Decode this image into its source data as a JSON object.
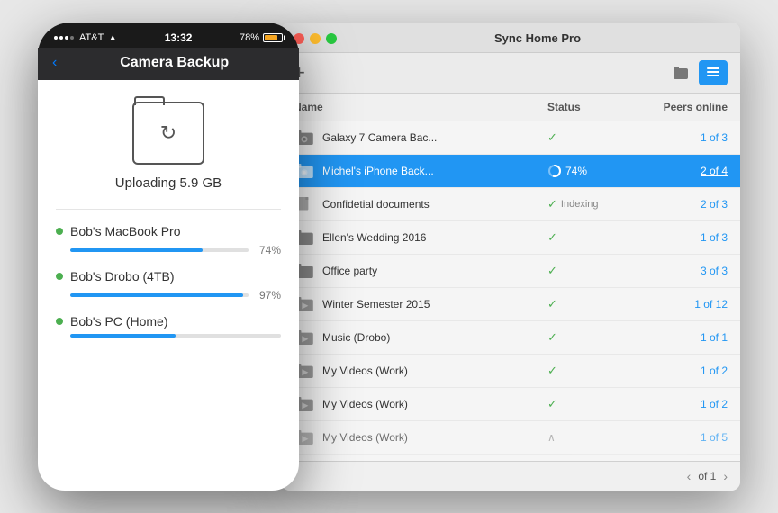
{
  "phone": {
    "carrier": "AT&T",
    "time": "13:32",
    "battery_percent": "78%",
    "back_label": "‹",
    "title": "Camera Backup",
    "upload_text": "Uploading 5.9 GB",
    "peers": [
      {
        "name": "Bob's MacBook Pro",
        "percent": "74%",
        "fill": 74,
        "active": true
      },
      {
        "name": "Bob's Drobo (4TB)",
        "percent": "97%",
        "fill": 97,
        "active": true
      },
      {
        "name": "Bob's PC (Home)",
        "percent": "50%",
        "fill": 50,
        "active": true
      }
    ]
  },
  "window": {
    "title": "Sync Home Pro",
    "add_label": "+",
    "columns": {
      "name": "Name",
      "status": "Status",
      "peers": "Peers online"
    },
    "rows": [
      {
        "icon": "camera",
        "name": "Galaxy 7 Camera Bac...",
        "status": "check",
        "peers": "1 of 3",
        "selected": false,
        "indexing": false
      },
      {
        "icon": "camera",
        "name": "Michel's iPhone Back...",
        "status": "progress",
        "peers": "2 of 4",
        "selected": true,
        "indexing": false,
        "progress": 74
      },
      {
        "icon": "doc",
        "name": "Confidetial documents",
        "status": "check",
        "peers": "2 of 3",
        "selected": false,
        "indexing": true
      },
      {
        "icon": "folder",
        "name": "Ellen's Wedding 2016",
        "status": "check",
        "peers": "1 of 3",
        "selected": false,
        "indexing": false
      },
      {
        "icon": "folder",
        "name": "Office party",
        "status": "check",
        "peers": "3 of 3",
        "selected": false,
        "indexing": false
      },
      {
        "icon": "media",
        "name": "Winter Semester 2015",
        "status": "check",
        "peers": "1 of 12",
        "selected": false,
        "indexing": false
      },
      {
        "icon": "media",
        "name": "Music (Drobo)",
        "status": "check",
        "peers": "1 of 1",
        "selected": false,
        "indexing": false
      },
      {
        "icon": "media",
        "name": "My Videos (Work)",
        "status": "check",
        "peers": "1 of 2",
        "selected": false,
        "indexing": false
      },
      {
        "icon": "media",
        "name": "My Videos (Work)",
        "status": "check",
        "peers": "1 of 2",
        "selected": false,
        "indexing": false
      },
      {
        "icon": "media",
        "name": "My Videos (Work)",
        "status": "chevron",
        "peers": "1 of 5",
        "selected": false,
        "indexing": false
      }
    ],
    "pagination": {
      "of_label": "of 1",
      "prev": "‹",
      "next": "›"
    }
  }
}
